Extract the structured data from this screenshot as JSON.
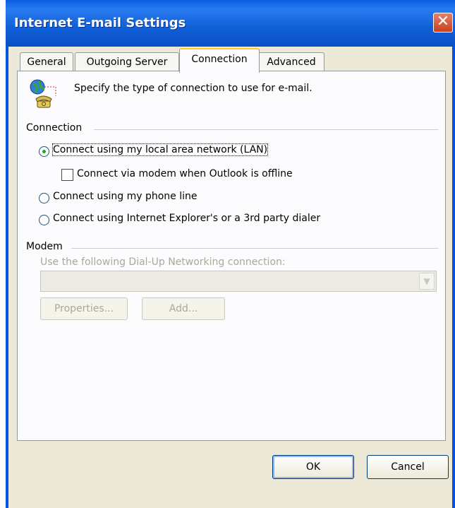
{
  "window": {
    "title": "Internet E-mail Settings",
    "close_glyph": "✕"
  },
  "tabs": [
    {
      "label": "General"
    },
    {
      "label": "Outgoing Server"
    },
    {
      "label": "Connection"
    },
    {
      "label": "Advanced"
    }
  ],
  "active_tab": "Connection",
  "intro": {
    "text": "Specify the type of connection to use for e-mail.",
    "icon": "globe-phone-icon"
  },
  "connection": {
    "group_label": "Connection",
    "options": [
      {
        "label": "Connect using my local area network (LAN)",
        "checked": true
      },
      {
        "label": "Connect using my phone line",
        "checked": false
      },
      {
        "label": "Connect using Internet Explorer's or a 3rd party dialer",
        "checked": false
      }
    ],
    "modem_offline_checkbox": {
      "label": "Connect via modem when Outlook is offline",
      "checked": false
    }
  },
  "modem": {
    "group_label": "Modem",
    "dialup_label": "Use the following Dial-Up Networking connection:",
    "dialup_value": "",
    "properties_button": "Properties...",
    "add_button": "Add..."
  },
  "footer": {
    "ok_label": "OK",
    "cancel_label": "Cancel"
  },
  "colors": {
    "titlebar": "#0054e3",
    "dialog_bg": "#ece9d8",
    "close_button": "#c9401f"
  }
}
